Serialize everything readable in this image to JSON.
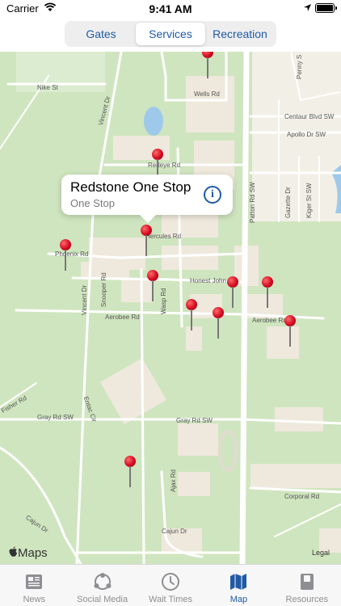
{
  "status_bar": {
    "carrier": "Carrier",
    "time": "9:41 AM"
  },
  "segments": [
    {
      "label": "Gates",
      "active": false
    },
    {
      "label": "Services",
      "active": true
    },
    {
      "label": "Recreation",
      "active": false
    }
  ],
  "callout": {
    "title": "Redstone One Stop",
    "subtitle": "One Stop",
    "info": "i"
  },
  "map": {
    "labels": {
      "nike": "Nike St",
      "wells": "Wells Rd",
      "centaur": "Centaur Blvd SW",
      "apollo": "Apollo Dr SW",
      "redeye": "Redeye Rd",
      "hercules": "Hercules Rd",
      "phoenix": "Phoenix Rd",
      "honest_john": "Honest John Rd",
      "aerobee_left": "Aerobee Rd",
      "aerobee_right": "Aerobee Rd",
      "gray_left": "Gray Rd SW",
      "gray_right": "Gray Rd SW",
      "corporal": "Corporal Rd",
      "cajun_left": "Cajun Dr",
      "cajun_bottom": "Cajun Dr",
      "fisher": "Fisher Rd",
      "entac": "Entac Cir",
      "vincent_top": "Vincent Dr",
      "vincent_mid": "Vincent Dr",
      "snooper": "Snooper Rd",
      "wasp": "Wasp Rd",
      "ajax": "Ajax Rd",
      "patton": "Patton Rd SW",
      "gazette": "Gazette Dr",
      "kiger": "Kiger St SW",
      "penny": "Penny S"
    },
    "logo": "Maps",
    "legal": "Legal"
  },
  "tabs": [
    {
      "label": "News",
      "icon": "news-icon",
      "active": false
    },
    {
      "label": "Social Media",
      "icon": "social-media-icon",
      "active": false
    },
    {
      "label": "Wait Times",
      "icon": "clock-icon",
      "active": false
    },
    {
      "label": "Map",
      "icon": "map-icon",
      "active": true
    },
    {
      "label": "Resources",
      "icon": "book-icon",
      "active": false
    }
  ],
  "colors": {
    "accent": "#1f5aa6",
    "pin": "#d0021b",
    "map_green": "#cfe5bf",
    "road": "#ffffff",
    "building": "#efe9dd",
    "water": "#9ec9ea"
  }
}
